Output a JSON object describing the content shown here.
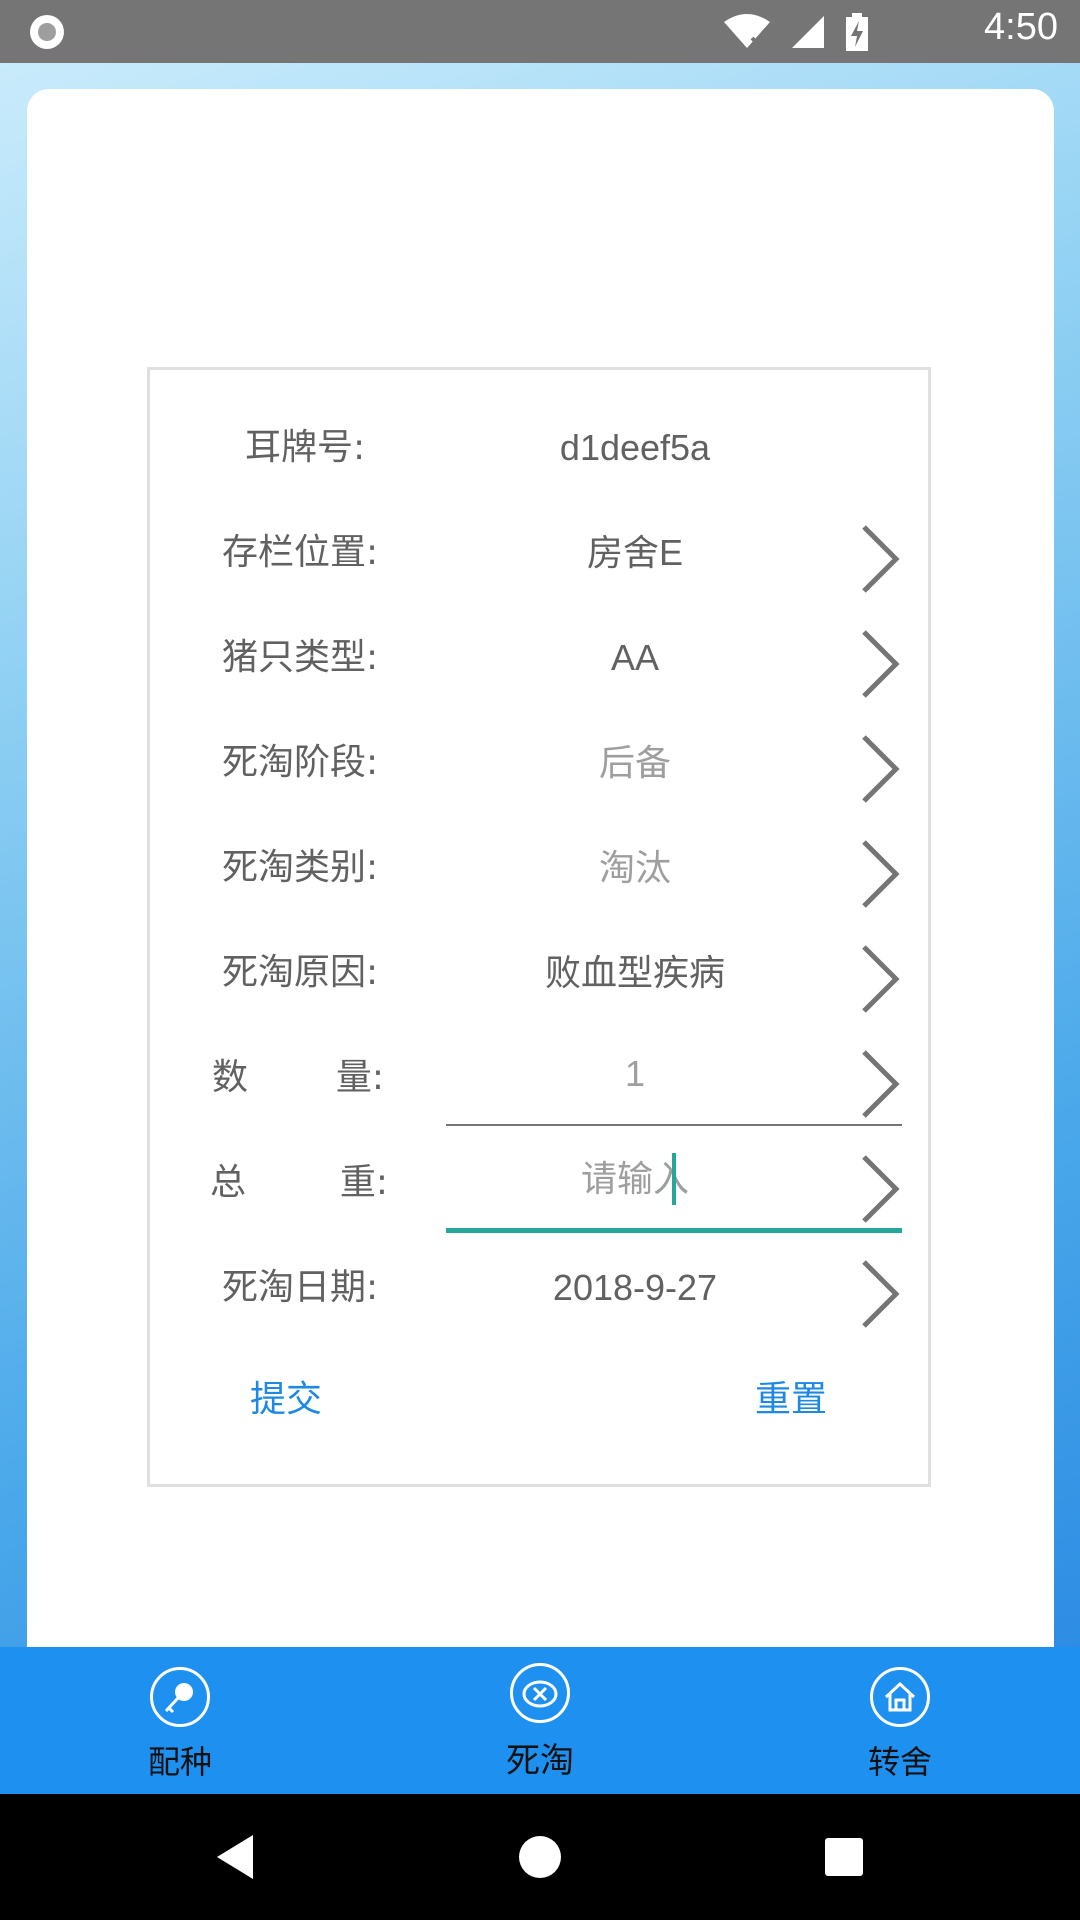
{
  "status_bar": {
    "time": "4:50",
    "icons": [
      "circle-indicator-icon",
      "wifi-icon",
      "signal-icon",
      "battery-charging-icon"
    ]
  },
  "form": {
    "rows": [
      {
        "label": "耳牌号:",
        "value": "d1deef5a",
        "has_chevron": false
      },
      {
        "label": "存栏位置:",
        "value": "房舍E",
        "has_chevron": true
      },
      {
        "label": "猪只类型:",
        "value": "AA",
        "has_chevron": true
      },
      {
        "label": "死淘阶段:",
        "value": "后备",
        "has_chevron": true
      },
      {
        "label": "死淘类别:",
        "value": "淘汰",
        "has_chevron": true
      },
      {
        "label": "死淘原因:",
        "value": "败血型疾病",
        "has_chevron": true
      },
      {
        "label_a": "数",
        "label_b": "量:",
        "value": "1",
        "has_chevron": true
      },
      {
        "label_a": "总",
        "label_b": "重:",
        "value": "",
        "placeholder": "请输入",
        "has_chevron": true
      },
      {
        "label": "死淘日期:",
        "value": "2018-9-27",
        "has_chevron": true
      }
    ],
    "submit_label": "提交",
    "reset_label": "重置"
  },
  "tabbar": {
    "tabs": [
      {
        "label": "配种",
        "icon": "magnifier-key-icon",
        "active": false
      },
      {
        "label": "死淘",
        "icon": "pig-cross-icon",
        "active": true
      },
      {
        "label": "转舍",
        "icon": "house-icon",
        "active": false
      }
    ]
  },
  "navbar": {
    "icons": [
      "back-icon",
      "home-icon",
      "recents-icon"
    ]
  },
  "colors": {
    "accent": "#1e88e5",
    "tabbar": "#1e90f0",
    "input_focus": "#26a69a"
  }
}
